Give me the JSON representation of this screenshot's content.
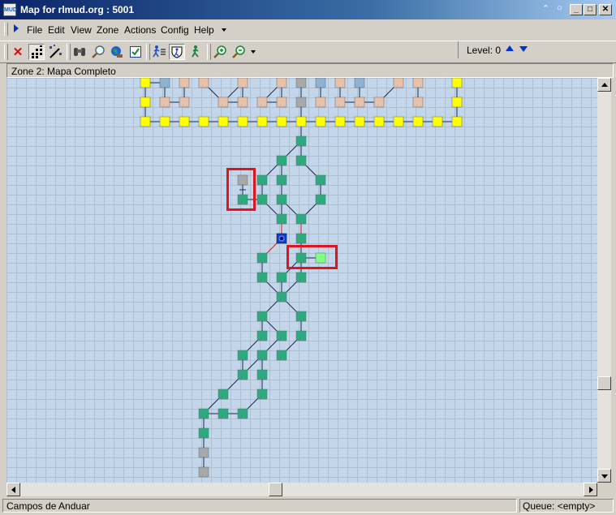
{
  "window": {
    "title": "Map for rlmud.org : 5001",
    "app_icon_text": "MUD"
  },
  "menu": {
    "items": [
      "File",
      "Edit",
      "View",
      "Zone",
      "Actions",
      "Config",
      "Help"
    ],
    "level_label": "Level: 0"
  },
  "toolbar": {
    "tools": [
      "delete-icon",
      "grid-icon",
      "magic-wand-icon",
      "binoculars-icon",
      "magnifier-icon",
      "globe-icon",
      "checkbox-icon",
      "walker-list-icon",
      "shield-walker-icon",
      "walker-icon",
      "zoom-in-icon",
      "zoom-out-icon"
    ]
  },
  "zone": {
    "title": "Zone 2: Mapa Completo"
  },
  "status": {
    "location": "Campos de Anduar",
    "queue": "Queue: <empty>"
  },
  "colors": {
    "room_green": "#2eaa7e",
    "room_yellow": "#ffff00",
    "room_tan": "#e8c0a8",
    "room_gray": "#a8a8a8",
    "room_blue": "#90b0d0",
    "room_lightgreen": "#80ff80",
    "current_room": "#1040d0",
    "highlight": "#e0141e"
  }
}
